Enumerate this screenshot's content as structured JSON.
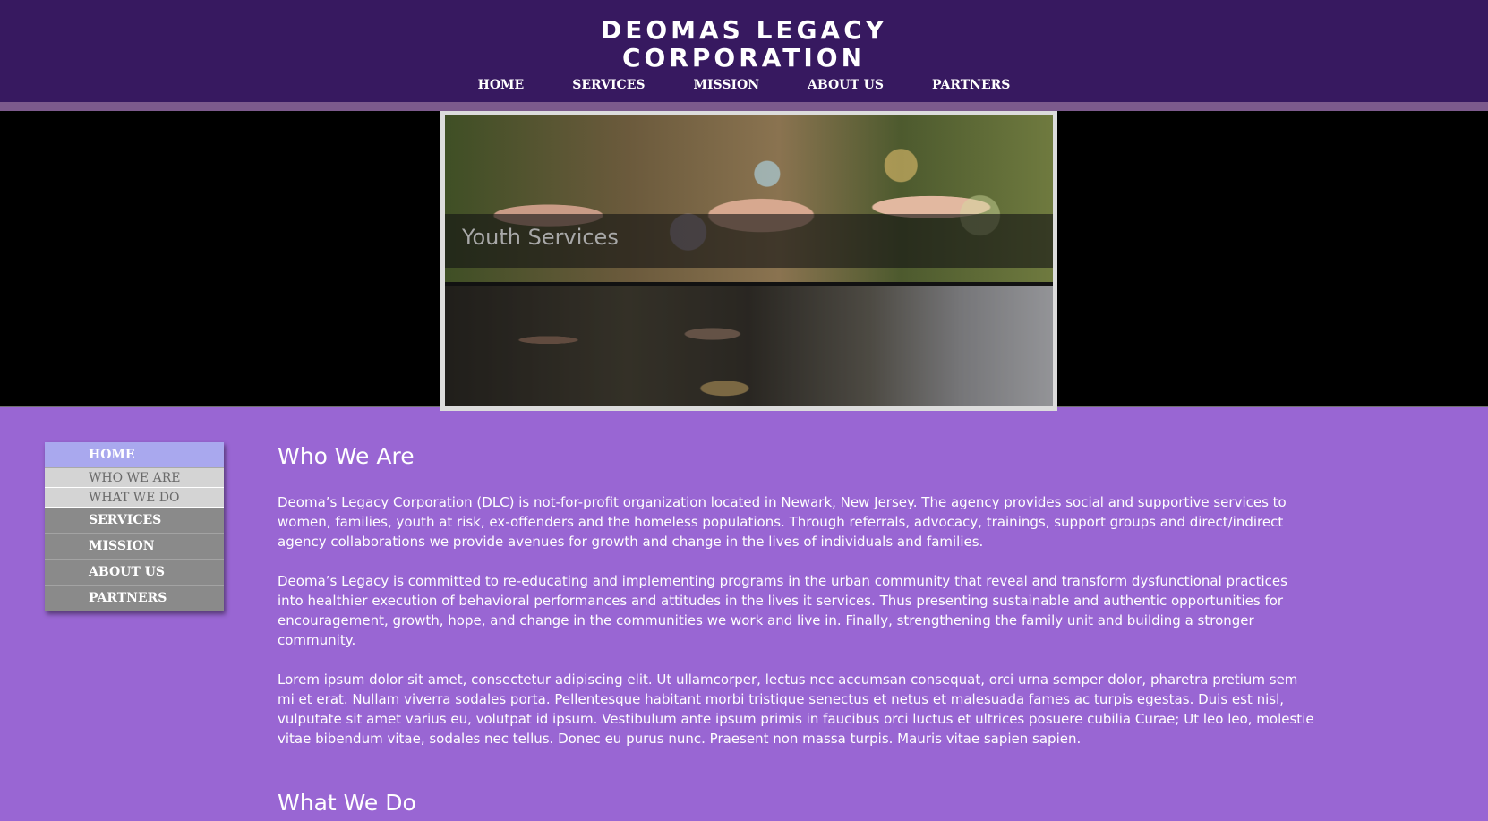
{
  "site": {
    "logo_line1": "DEOMAS LEGACY",
    "logo_line2": "CORPORATION"
  },
  "topnav": {
    "items": [
      {
        "label": "HOME"
      },
      {
        "label": "SERVICES"
      },
      {
        "label": "MISSION"
      },
      {
        "label": "ABOUT US"
      },
      {
        "label": "PARTNERS"
      }
    ]
  },
  "banner": {
    "caption": "Youth Services"
  },
  "sidemenu": {
    "items": [
      {
        "label": "HOME",
        "state": "active"
      },
      {
        "label": "WHO WE ARE",
        "state": "submenu"
      },
      {
        "label": "WHAT WE DO",
        "state": "submenu"
      },
      {
        "label": "SERVICES",
        "state": "normal"
      },
      {
        "label": "MISSION",
        "state": "normal"
      },
      {
        "label": "ABOUT US",
        "state": "normal"
      },
      {
        "label": "PARTNERS",
        "state": "normal"
      }
    ]
  },
  "main": {
    "heading_who": "Who We Are",
    "paragraph1": "Deoma’s Legacy Corporation (DLC) is not-for-profit organization located in Newark, New Jersey. The agency provides social and supportive services to women, families, youth at risk, ex-offenders and the homeless populations. Through referrals, advocacy, trainings, support groups and direct/indirect agency collaborations we provide avenues for growth and change in the lives of individuals and families.",
    "paragraph2": "Deoma’s Legacy is committed to re-educating and implementing programs in the urban community that reveal and transform dysfunctional practices into healthier execution of behavioral performances and attitudes in the lives it services. Thus presenting sustainable and authentic opportunities for encouragement, growth, hope, and change in the communities we work and live in. Finally, strengthening the family unit and building a stronger community.",
    "paragraph3": "Lorem ipsum dolor sit amet, consectetur adipiscing elit. Ut ullamcorper, lectus nec accumsan consequat, orci urna semper dolor, pharetra pretium sem mi et erat. Nullam viverra sodales porta. Pellentesque habitant morbi tristique senectus et netus et malesuada fames ac turpis egestas. Duis est nisl, vulputate sit amet varius eu, volutpat id ipsum. Vestibulum ante ipsum primis in faucibus orci luctus et ultrices posuere cubilia Curae; Ut leo leo, molestie vitae bibendum vitae, sodales nec tellus. Donec eu purus nunc. Praesent non massa turpis. Mauris vitae sapien sapien.",
    "heading_what": "What We Do"
  },
  "colors": {
    "header_bg": "#371960",
    "header_border": "#7c5a8c",
    "page_bg": "#9966d3",
    "menu_active": "#a9a8ee",
    "menu_sub": "#d4d4d4",
    "menu_item": "#8a8a8a"
  }
}
